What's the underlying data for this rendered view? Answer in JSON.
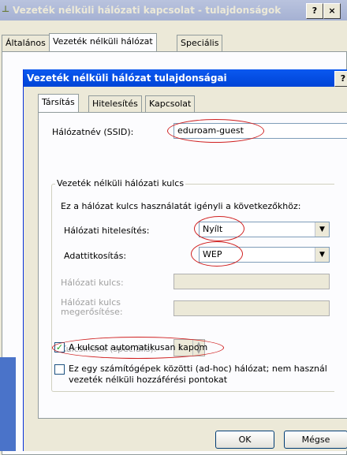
{
  "background_window": {
    "title": "Vezeték nélküli hálózati kapcsolat - tulajdonságok",
    "help_button": "?",
    "close_button": "×",
    "tabs": [
      {
        "label": "Általános"
      },
      {
        "label": "Vezeték nélküli hálózat"
      },
      {
        "label": "Speciális"
      }
    ]
  },
  "dialog": {
    "title": "Vezeték nélküli hálózat tulajdonságai",
    "help_button": "?",
    "tabs": [
      {
        "label": "Társítás"
      },
      {
        "label": "Hitelesítés"
      },
      {
        "label": "Kapcsolat"
      }
    ],
    "ssid": {
      "label": "Hálózatnév (SSID):",
      "value": "eduroam-guest"
    },
    "key_group": {
      "title": "Vezeték nélküli hálózati kulcs",
      "description": "Ez a hálózat kulcs használatát igényli a következőkhöz:",
      "auth": {
        "label": "Hálózati hitelesítés:",
        "value": "Nyílt"
      },
      "encryption": {
        "label": "Adattitkosítás:",
        "value": "WEP"
      },
      "network_key_label": "Hálózati kulcs:",
      "confirm_key_label_line1": "Hálózati kulcs",
      "confirm_key_label_line2": "megerősítése:",
      "key_index": {
        "label": "Kulcsindex (speciális):",
        "value": "1"
      },
      "auto_key": {
        "label": "A kulcsot automatikusan kapom",
        "checked": true
      }
    },
    "adhoc": {
      "line1": "Ez egy számítógépek közötti (ad-hoc) hálózat; nem használ",
      "line2": "vezeték nélküli hozzáférési pontokat",
      "checked": false
    },
    "ok_label": "OK",
    "cancel_label": "Mégse"
  },
  "colors": {
    "dialog_title_bar": "#0a58f0",
    "annotation_oval": "#d02020",
    "window_background": "#ece9d8"
  }
}
